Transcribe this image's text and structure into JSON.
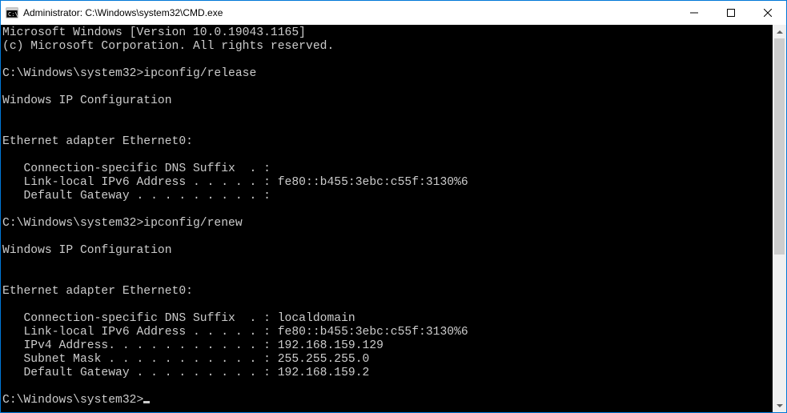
{
  "window": {
    "title": "Administrator: C:\\Windows\\system32\\CMD.exe"
  },
  "console": {
    "lines": [
      "Microsoft Windows [Version 10.0.19043.1165]",
      "(c) Microsoft Corporation. All rights reserved.",
      "",
      "C:\\Windows\\system32>ipconfig/release",
      "",
      "Windows IP Configuration",
      "",
      "",
      "Ethernet adapter Ethernet0:",
      "",
      "   Connection-specific DNS Suffix  . :",
      "   Link-local IPv6 Address . . . . . : fe80::b455:3ebc:c55f:3130%6",
      "   Default Gateway . . . . . . . . . :",
      "",
      "C:\\Windows\\system32>ipconfig/renew",
      "",
      "Windows IP Configuration",
      "",
      "",
      "Ethernet adapter Ethernet0:",
      "",
      "   Connection-specific DNS Suffix  . : localdomain",
      "   Link-local IPv6 Address . . . . . : fe80::b455:3ebc:c55f:3130%6",
      "   IPv4 Address. . . . . . . . . . . : 192.168.159.129",
      "   Subnet Mask . . . . . . . . . . . : 255.255.255.0",
      "   Default Gateway . . . . . . . . . : 192.168.159.2",
      ""
    ],
    "prompt": "C:\\Windows\\system32>"
  }
}
